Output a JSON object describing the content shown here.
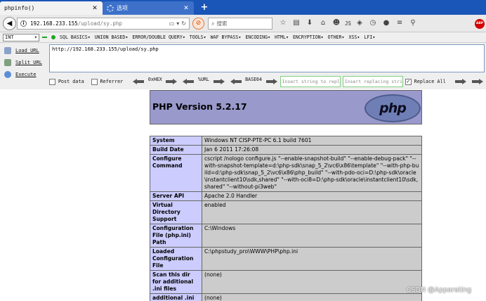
{
  "tabs": [
    {
      "title": "phpinfo()",
      "active": true
    },
    {
      "title": "选项",
      "active": false
    }
  ],
  "navbar": {
    "url_host": "192.168.233.155",
    "url_path": "/upload/sy.php",
    "search_placeholder": "搜索",
    "js_label": "JS"
  },
  "hackbar": {
    "select_value": "INT",
    "menu": [
      "SQL BASICS",
      "UNION BASED",
      "ERROR/DOUBLE QUERY",
      "TOOLS",
      "WAF BYPASS",
      "ENCODING",
      "HTML",
      "ENCRYPTION",
      "OTHER",
      "XSS",
      "LFI"
    ],
    "actions": [
      "Load URL",
      "Split URL",
      "Execute"
    ],
    "textarea_value": "http://192.168.233.155/upload/sy.php",
    "post_data_label": "Post data",
    "referrer_label": "Referrer",
    "enc1_label": "0xHEX",
    "enc2_label": "%URL",
    "enc3_label": "BASE64",
    "insert_placeholder": "Insert string to replace",
    "replacing_placeholder": "Insert replacing string",
    "replace_all_label": "Replace All"
  },
  "page": {
    "php_version_title": "PHP Version 5.2.17",
    "php_logo_text": "php",
    "rows": [
      {
        "key": "System",
        "value": "Windows NT CISP-PTE-PC 6.1 build 7601"
      },
      {
        "key": "Build Date",
        "value": "Jan 6 2011 17:26:08"
      },
      {
        "key": "Configure Command",
        "value": "cscript /nologo configure.js \"--enable-snapshot-build\" \"--enable-debug-pack\" \"--with-snapshot-template=d:\\php-sdk\\snap_5_2\\vc6\\x86\\template\" \"--with-php-build=d:\\php-sdk\\snap_5_2\\vc6\\x86\\php_build\" \"--with-pdo-oci=D:\\php-sdk\\oracle\\instantclient10\\sdk,shared\" \"--with-oci8=D:\\php-sdk\\oracle\\instantclient10\\sdk,shared\" \"--without-pi3web\""
      },
      {
        "key": "Server API",
        "value": "Apache 2.0 Handler"
      },
      {
        "key": "Virtual Directory Support",
        "value": "enabled"
      },
      {
        "key": "Configuration File (php.ini) Path",
        "value": "C:\\Windows"
      },
      {
        "key": "Loaded Configuration File",
        "value": "C:\\phpstudy_pro\\WWW\\PHP\\php.ini"
      },
      {
        "key": "Scan this dir for additional .ini files",
        "value": "(none)"
      },
      {
        "key": "additional .ini files parsed",
        "value": "(none)"
      }
    ]
  },
  "watermark": "CSDN @Apparating",
  "colors": {
    "tabstrip": "#1a55b8",
    "php_header": "#9999cc",
    "key_cell": "#ccccff",
    "value_cell": "#cccccc"
  }
}
